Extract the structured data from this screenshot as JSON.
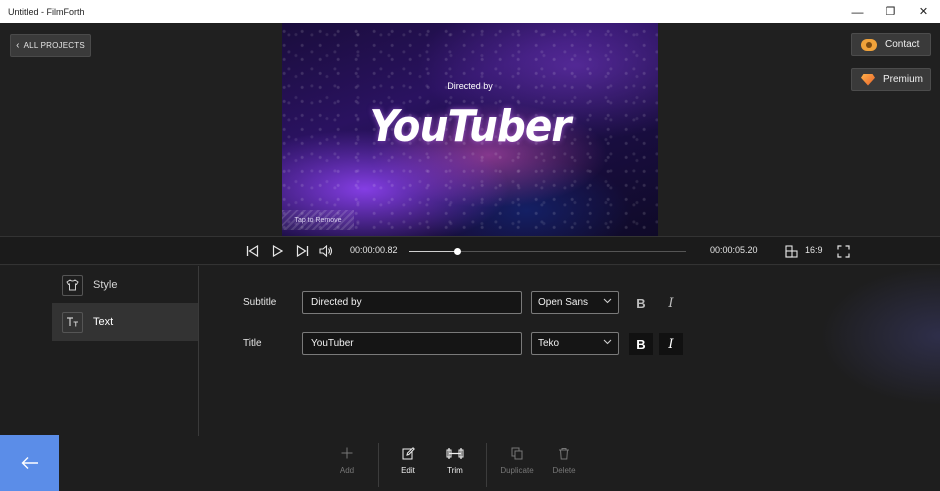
{
  "window": {
    "title": "Untitled - FilmForth",
    "minimize_glyph": "—",
    "maximize_glyph": "❐",
    "close_glyph": "✕"
  },
  "header": {
    "all_projects_label": "ALL PROJECTS",
    "contact_label": "Contact",
    "premium_label": "Premium"
  },
  "preview": {
    "subtitle": "Directed by",
    "title": "YouTuber",
    "tap_remove_label": "Tap to Remove"
  },
  "player": {
    "current_time": "00:00:00.82",
    "total_time": "00:00:05.20",
    "progress_fraction": 0.174,
    "aspect_ratio": "16:9"
  },
  "sidebar": {
    "items": [
      {
        "label": "Style",
        "icon": "shirt-icon",
        "glyph": "👕",
        "active": false
      },
      {
        "label": "Text",
        "icon": "text-icon",
        "glyph": "Tт",
        "active": true
      }
    ]
  },
  "text_settings": {
    "subtitle": {
      "label": "Subtitle",
      "value": "Directed by",
      "font": "Open Sans",
      "bold_active": false,
      "italic_active": false
    },
    "title": {
      "label": "Title",
      "value": "YouTuber",
      "font": "Teko",
      "bold_active": true,
      "italic_active": true
    }
  },
  "toolbar": {
    "add_label": "Add",
    "edit_label": "Edit",
    "trim_label": "Trim",
    "duplicate_label": "Duplicate",
    "delete_label": "Delete"
  },
  "colors": {
    "accent": "#5b8de8",
    "background": "#1e1e1e",
    "contact_icon": "#f0a23a",
    "premium_icon": "#e8602a"
  }
}
